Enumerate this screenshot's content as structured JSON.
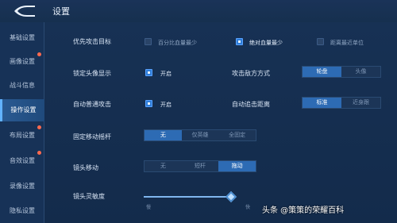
{
  "header": {
    "title": "设置"
  },
  "sidebar": {
    "items": [
      {
        "label": "基础设置",
        "active": false,
        "badge": false
      },
      {
        "label": "画像设置",
        "active": false,
        "badge": true
      },
      {
        "label": "战斗信息",
        "active": false,
        "badge": false
      },
      {
        "label": "操作设置",
        "active": true,
        "badge": false
      },
      {
        "label": "布局设置",
        "active": false,
        "badge": true
      },
      {
        "label": "音效设置",
        "active": false,
        "badge": true
      },
      {
        "label": "录像设置",
        "active": false,
        "badge": false
      },
      {
        "label": "隐私设置",
        "active": false,
        "badge": false
      }
    ]
  },
  "settings": {
    "priority_target": {
      "label": "优先攻击目标",
      "options": [
        {
          "label": "百分比血量最少",
          "checked": false
        },
        {
          "label": "绝对血量最少",
          "checked": true
        },
        {
          "label": "距离最近单位",
          "checked": false
        }
      ]
    },
    "lock_avatar": {
      "label": "锁定头像显示",
      "option": "开启",
      "checked": true
    },
    "attack_enemy": {
      "label": "攻击敌方方式",
      "options": [
        {
          "label": "轮盘",
          "selected": true
        },
        {
          "label": "头像",
          "selected": false
        }
      ]
    },
    "auto_attack": {
      "label": "自动普通攻击",
      "option": "开启",
      "checked": true
    },
    "auto_track": {
      "label": "自动追击距离",
      "options": [
        {
          "label": "标准",
          "selected": true
        },
        {
          "label": "近身跟",
          "selected": false
        }
      ]
    },
    "fixed_joystick": {
      "label": "固定移动摇杆",
      "options": [
        {
          "label": "无",
          "selected": true
        },
        {
          "label": "仅英雄",
          "selected": false
        },
        {
          "label": "全固定",
          "selected": false
        }
      ]
    },
    "camera_move": {
      "label": "镜头移动",
      "options": [
        {
          "label": "无",
          "selected": false
        },
        {
          "label": "短杆",
          "selected": false
        },
        {
          "label": "拖动",
          "selected": true
        }
      ]
    },
    "camera_sensitivity": {
      "label": "镜头灵敏度",
      "value": 1.0,
      "min_label": "慢",
      "max_label": "快"
    }
  },
  "watermark": "头条 @策策的荣耀百科"
}
